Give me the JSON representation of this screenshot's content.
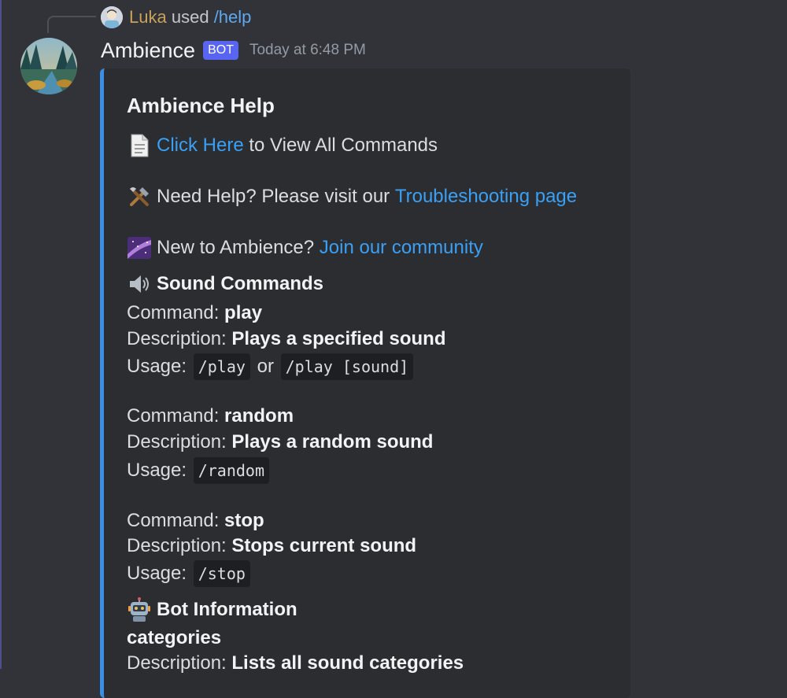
{
  "reply": {
    "user": "Luka",
    "used_text": "used",
    "command": "/help"
  },
  "message": {
    "author": "Ambience",
    "badge": "BOT",
    "timestamp": "Today at 6:48 PM"
  },
  "embed": {
    "accent_color": "#3a8ee6",
    "title": "Ambience Help",
    "commands_link": "Click Here",
    "commands_rest": "to View All Commands",
    "help_prefix": "Need Help? Please visit our",
    "help_link": "Troubleshooting page",
    "new_prefix": "New to Ambience?",
    "new_link": "Join our community",
    "sound_section_title": "Sound Commands",
    "sound_commands": [
      {
        "command_label": "Command:",
        "command": "play",
        "desc_label": "Description:",
        "description": "Plays a specified sound",
        "usage_label": "Usage:",
        "usage": [
          "/play",
          "/play [sound]"
        ],
        "usage_join": "or"
      },
      {
        "command_label": "Command:",
        "command": "random",
        "desc_label": "Description:",
        "description": "Plays a random sound",
        "usage_label": "Usage:",
        "usage": [
          "/random"
        ]
      },
      {
        "command_label": "Command:",
        "command": "stop",
        "desc_label": "Description:",
        "description": "Stops current sound",
        "usage_label": "Usage:",
        "usage": [
          "/stop"
        ]
      }
    ],
    "bot_section_title": "Bot Information",
    "bot_items": [
      {
        "name": "categories",
        "desc_label": "Description:",
        "description": "Lists all sound categories"
      }
    ]
  }
}
